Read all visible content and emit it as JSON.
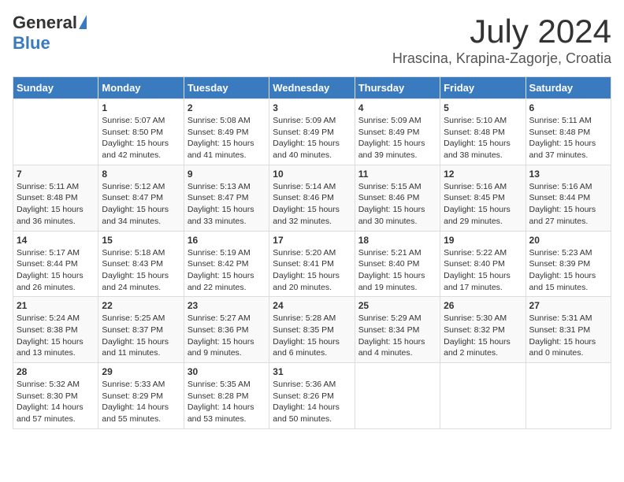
{
  "header": {
    "logo_general": "General",
    "logo_blue": "Blue",
    "month_title": "July 2024",
    "location": "Hrascina, Krapina-Zagorje, Croatia"
  },
  "calendar": {
    "days_of_week": [
      "Sunday",
      "Monday",
      "Tuesday",
      "Wednesday",
      "Thursday",
      "Friday",
      "Saturday"
    ],
    "weeks": [
      [
        {
          "day": "",
          "info": ""
        },
        {
          "day": "1",
          "info": "Sunrise: 5:07 AM\nSunset: 8:50 PM\nDaylight: 15 hours\nand 42 minutes."
        },
        {
          "day": "2",
          "info": "Sunrise: 5:08 AM\nSunset: 8:49 PM\nDaylight: 15 hours\nand 41 minutes."
        },
        {
          "day": "3",
          "info": "Sunrise: 5:09 AM\nSunset: 8:49 PM\nDaylight: 15 hours\nand 40 minutes."
        },
        {
          "day": "4",
          "info": "Sunrise: 5:09 AM\nSunset: 8:49 PM\nDaylight: 15 hours\nand 39 minutes."
        },
        {
          "day": "5",
          "info": "Sunrise: 5:10 AM\nSunset: 8:48 PM\nDaylight: 15 hours\nand 38 minutes."
        },
        {
          "day": "6",
          "info": "Sunrise: 5:11 AM\nSunset: 8:48 PM\nDaylight: 15 hours\nand 37 minutes."
        }
      ],
      [
        {
          "day": "7",
          "info": "Sunrise: 5:11 AM\nSunset: 8:48 PM\nDaylight: 15 hours\nand 36 minutes."
        },
        {
          "day": "8",
          "info": "Sunrise: 5:12 AM\nSunset: 8:47 PM\nDaylight: 15 hours\nand 34 minutes."
        },
        {
          "day": "9",
          "info": "Sunrise: 5:13 AM\nSunset: 8:47 PM\nDaylight: 15 hours\nand 33 minutes."
        },
        {
          "day": "10",
          "info": "Sunrise: 5:14 AM\nSunset: 8:46 PM\nDaylight: 15 hours\nand 32 minutes."
        },
        {
          "day": "11",
          "info": "Sunrise: 5:15 AM\nSunset: 8:46 PM\nDaylight: 15 hours\nand 30 minutes."
        },
        {
          "day": "12",
          "info": "Sunrise: 5:16 AM\nSunset: 8:45 PM\nDaylight: 15 hours\nand 29 minutes."
        },
        {
          "day": "13",
          "info": "Sunrise: 5:16 AM\nSunset: 8:44 PM\nDaylight: 15 hours\nand 27 minutes."
        }
      ],
      [
        {
          "day": "14",
          "info": "Sunrise: 5:17 AM\nSunset: 8:44 PM\nDaylight: 15 hours\nand 26 minutes."
        },
        {
          "day": "15",
          "info": "Sunrise: 5:18 AM\nSunset: 8:43 PM\nDaylight: 15 hours\nand 24 minutes."
        },
        {
          "day": "16",
          "info": "Sunrise: 5:19 AM\nSunset: 8:42 PM\nDaylight: 15 hours\nand 22 minutes."
        },
        {
          "day": "17",
          "info": "Sunrise: 5:20 AM\nSunset: 8:41 PM\nDaylight: 15 hours\nand 20 minutes."
        },
        {
          "day": "18",
          "info": "Sunrise: 5:21 AM\nSunset: 8:40 PM\nDaylight: 15 hours\nand 19 minutes."
        },
        {
          "day": "19",
          "info": "Sunrise: 5:22 AM\nSunset: 8:40 PM\nDaylight: 15 hours\nand 17 minutes."
        },
        {
          "day": "20",
          "info": "Sunrise: 5:23 AM\nSunset: 8:39 PM\nDaylight: 15 hours\nand 15 minutes."
        }
      ],
      [
        {
          "day": "21",
          "info": "Sunrise: 5:24 AM\nSunset: 8:38 PM\nDaylight: 15 hours\nand 13 minutes."
        },
        {
          "day": "22",
          "info": "Sunrise: 5:25 AM\nSunset: 8:37 PM\nDaylight: 15 hours\nand 11 minutes."
        },
        {
          "day": "23",
          "info": "Sunrise: 5:27 AM\nSunset: 8:36 PM\nDaylight: 15 hours\nand 9 minutes."
        },
        {
          "day": "24",
          "info": "Sunrise: 5:28 AM\nSunset: 8:35 PM\nDaylight: 15 hours\nand 6 minutes."
        },
        {
          "day": "25",
          "info": "Sunrise: 5:29 AM\nSunset: 8:34 PM\nDaylight: 15 hours\nand 4 minutes."
        },
        {
          "day": "26",
          "info": "Sunrise: 5:30 AM\nSunset: 8:32 PM\nDaylight: 15 hours\nand 2 minutes."
        },
        {
          "day": "27",
          "info": "Sunrise: 5:31 AM\nSunset: 8:31 PM\nDaylight: 15 hours\nand 0 minutes."
        }
      ],
      [
        {
          "day": "28",
          "info": "Sunrise: 5:32 AM\nSunset: 8:30 PM\nDaylight: 14 hours\nand 57 minutes."
        },
        {
          "day": "29",
          "info": "Sunrise: 5:33 AM\nSunset: 8:29 PM\nDaylight: 14 hours\nand 55 minutes."
        },
        {
          "day": "30",
          "info": "Sunrise: 5:35 AM\nSunset: 8:28 PM\nDaylight: 14 hours\nand 53 minutes."
        },
        {
          "day": "31",
          "info": "Sunrise: 5:36 AM\nSunset: 8:26 PM\nDaylight: 14 hours\nand 50 minutes."
        },
        {
          "day": "",
          "info": ""
        },
        {
          "day": "",
          "info": ""
        },
        {
          "day": "",
          "info": ""
        }
      ]
    ]
  }
}
